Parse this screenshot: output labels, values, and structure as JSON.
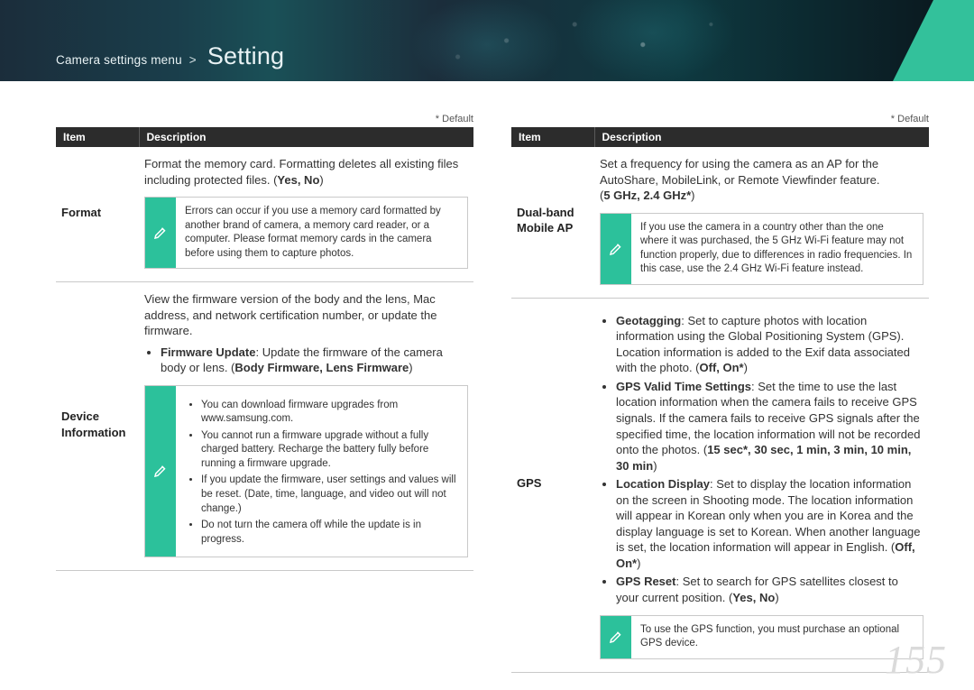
{
  "breadcrumb": {
    "prefix": "Camera settings menu",
    "sep": ">",
    "current": "Setting"
  },
  "default_label": "* Default",
  "headers": {
    "item": "Item",
    "desc": "Description"
  },
  "page_number": "155",
  "left_rows": [
    {
      "item": "Format",
      "desc_main": "Format the memory card. Formatting deletes all existing files including protected files. (",
      "desc_opts": "Yes, No",
      "desc_end": ")",
      "note_single": "Errors can occur if you use a memory card formatted by another brand of camera, a memory card reader, or a computer. Please format memory cards in the camera before using them to capture photos."
    },
    {
      "item": "Device Information",
      "para": "View the firmware version of the body and the lens, Mac address, and network certification number, or update the firmware.",
      "bullets": [
        {
          "lead": "Firmware Update",
          "text": ": Update the firmware of the camera body or lens. (",
          "opts": "Body Firmware, Lens Firmware",
          "end": ")"
        }
      ],
      "note_list": [
        "You can download firmware upgrades from www.samsung.com.",
        "You cannot run a firmware upgrade without a fully charged battery. Recharge the battery fully before running a firmware upgrade.",
        "If you update the firmware, user settings and values will be reset. (Date, time, language, and video out will not change.)",
        "Do not turn the camera off while the update is in progress."
      ]
    }
  ],
  "right_rows": [
    {
      "item": "Dual-band Mobile AP",
      "desc_main": "Set a frequency for using the camera as an AP for the AutoShare, MobileLink, or Remote Viewfinder feature.\n(",
      "desc_opts": "5 GHz, 2.4 GHz*",
      "desc_end": ")",
      "note_single": "If you use the camera in a country other than the one where it was purchased, the 5 GHz Wi-Fi feature may not function properly, due to differences in radio frequencies. In this case, use the 2.4 GHz Wi-Fi feature instead."
    },
    {
      "item": "GPS",
      "bullets": [
        {
          "lead": "Geotagging",
          "text": ": Set to capture photos with location information using the Global Positioning System (GPS). Location information is added to the Exif data associated with the photo. (",
          "opts": "Off, On*",
          "end": ")"
        },
        {
          "lead": "GPS Valid Time Settings",
          "text": ": Set the time to use the last location information when the camera fails to receive GPS signals. If the camera fails to receive GPS signals after the specified time, the location information will not be recorded onto the photos. (",
          "opts": "15 sec*, 30 sec, 1 min, 3 min, 10 min, 30 min",
          "end": ")"
        },
        {
          "lead": "Location Display",
          "text": ": Set to display the location information on the screen in Shooting mode. The location information will appear in Korean only when you are in Korea and the display language is set to Korean. When another language is set, the location information will appear in English. (",
          "opts": "Off, On*",
          "end": ")"
        },
        {
          "lead": "GPS Reset",
          "text": ": Set to search for GPS satellites closest to your current position. (",
          "opts": "Yes, No",
          "end": ")"
        }
      ],
      "note_single": "To use the GPS function, you must purchase an optional GPS device."
    }
  ]
}
